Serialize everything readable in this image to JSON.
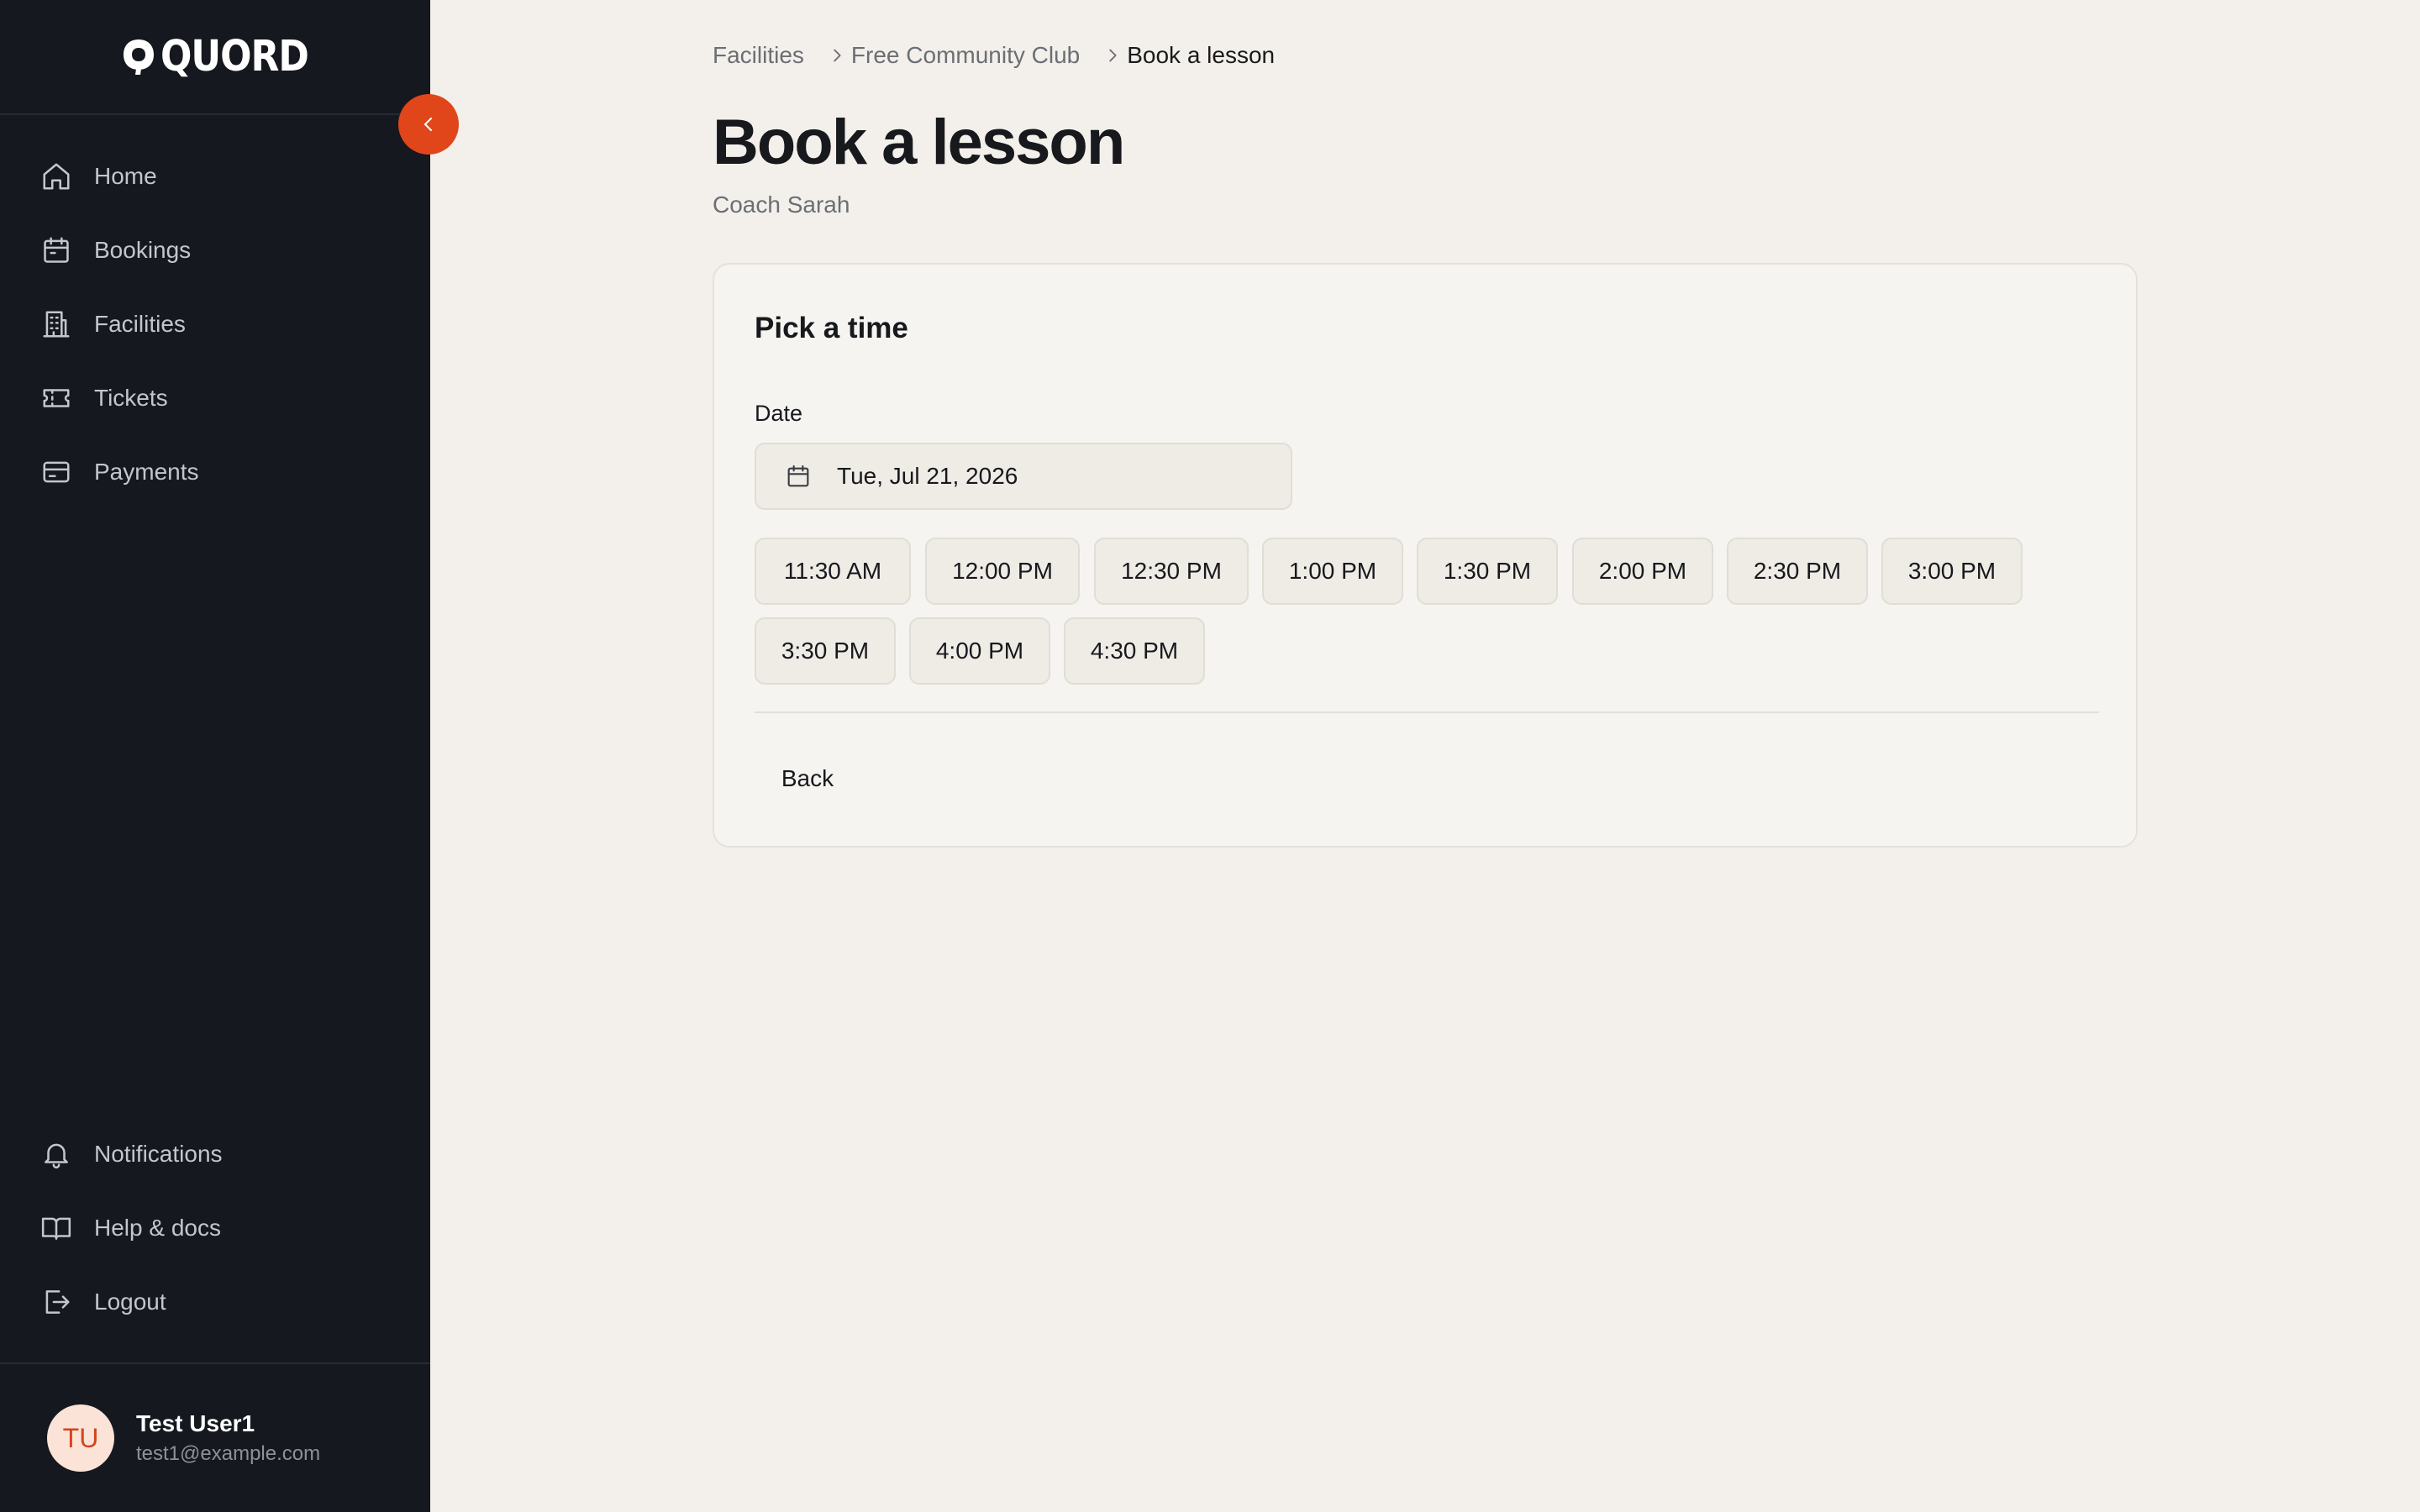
{
  "brand": {
    "name": "QUORD"
  },
  "sidebar": {
    "items": [
      {
        "label": "Home",
        "icon": "home-icon"
      },
      {
        "label": "Bookings",
        "icon": "calendar-icon"
      },
      {
        "label": "Facilities",
        "icon": "building-icon"
      },
      {
        "label": "Tickets",
        "icon": "ticket-icon"
      },
      {
        "label": "Payments",
        "icon": "credit-card-icon"
      }
    ],
    "bottom_items": [
      {
        "label": "Notifications",
        "icon": "bell-icon"
      },
      {
        "label": "Help & docs",
        "icon": "book-icon"
      },
      {
        "label": "Logout",
        "icon": "logout-icon"
      }
    ],
    "collapse_icon": "chevron-left-icon"
  },
  "user": {
    "initials": "TU",
    "name": "Test User1",
    "email": "test1@example.com"
  },
  "breadcrumb": {
    "items": [
      "Facilities",
      "Free Community Club",
      "Book a lesson"
    ]
  },
  "page": {
    "title": "Book a lesson",
    "subtitle": "Coach Sarah"
  },
  "card": {
    "title": "Pick a time",
    "date_label": "Date",
    "date_value": "Tue, Jul 21, 2026",
    "back_label": "Back"
  },
  "slots": [
    "11:30 AM",
    "12:00 PM",
    "12:30 PM",
    "1:00 PM",
    "1:30 PM",
    "2:00 PM",
    "2:30 PM",
    "3:00 PM",
    "3:30 PM",
    "4:00 PM",
    "4:30 PM"
  ],
  "colors": {
    "sidebar_bg": "#15181f",
    "page_bg": "#f3f0eb",
    "accent": "#e0461a",
    "avatar_bg": "#fbe3d7"
  }
}
